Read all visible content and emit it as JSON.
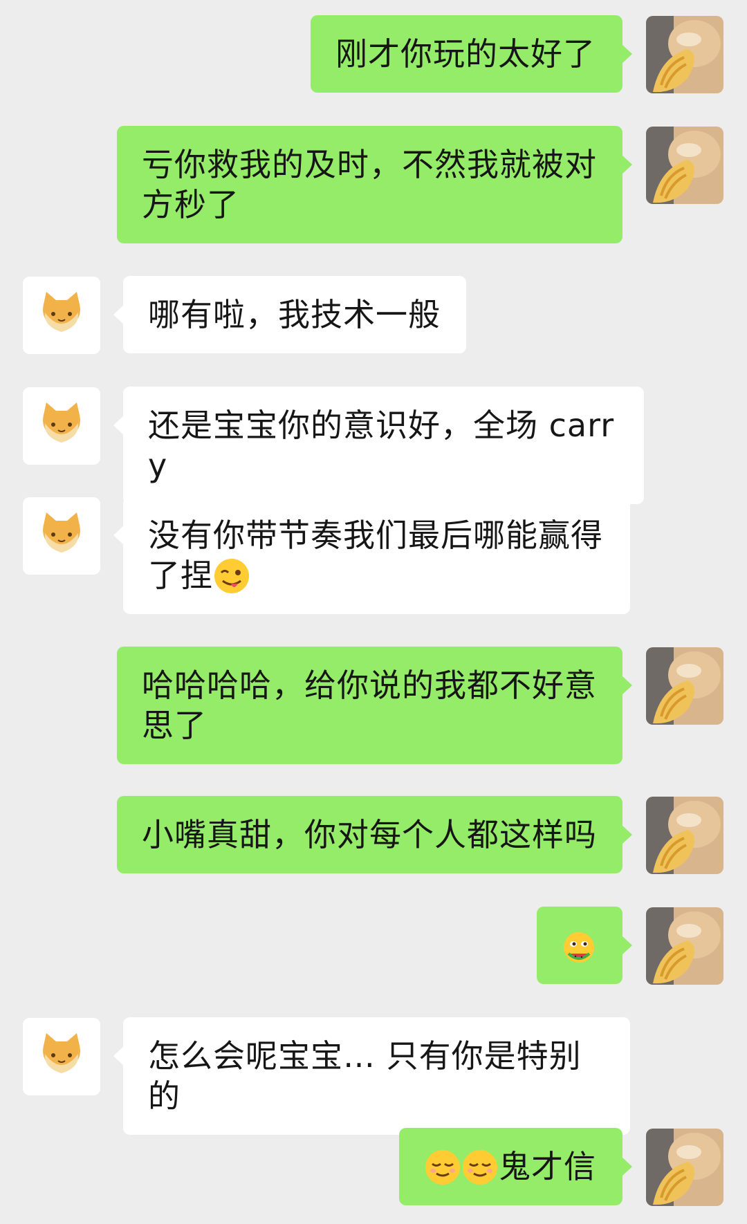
{
  "messages": [
    {
      "side": "me",
      "text": "刚才你玩的太好了"
    },
    {
      "side": "me",
      "text": "亏你救我的及时，不然我就被对方秒了"
    },
    {
      "side": "other",
      "text": "哪有啦，我技术一般"
    },
    {
      "side": "other",
      "text": "还是宝宝你的意识好，全场 carry"
    },
    {
      "side": "other",
      "text": "没有你带节奏我们最后哪能赢得了捏",
      "emoji": "winking-tongue-emoji"
    },
    {
      "side": "me",
      "text": "哈哈哈哈，给你说的我都不好意思了"
    },
    {
      "side": "me",
      "text": "小嘴真甜，你对每个人都这样吗"
    },
    {
      "side": "me",
      "text": "",
      "emoji": "eating-watermelon-emoji"
    },
    {
      "side": "other",
      "text": "怎么会呢宝宝… 只有你是特别的"
    },
    {
      "side": "me",
      "text": "鬼才信",
      "emoji_prefix": [
        "relieved-face-emoji",
        "relieved-face-emoji"
      ]
    }
  ],
  "avatars": {
    "me": "cat-with-fish-photo-icon",
    "other": "orange-cat-face-icon"
  },
  "colors": {
    "background": "#ededed",
    "my_bubble": "#95ec69",
    "their_bubble": "#ffffff",
    "text": "#161616"
  }
}
